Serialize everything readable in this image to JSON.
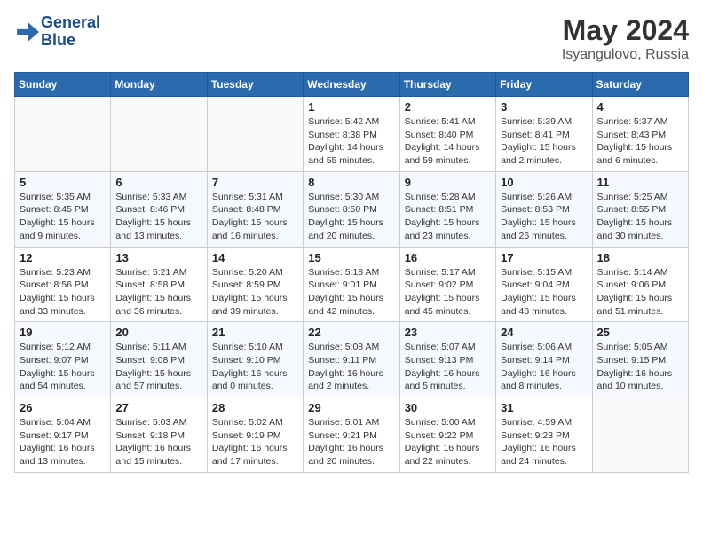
{
  "header": {
    "logo_line1": "General",
    "logo_line2": "Blue",
    "month_title": "May 2024",
    "location": "Isyangulovo, Russia"
  },
  "days_of_week": [
    "Sunday",
    "Monday",
    "Tuesday",
    "Wednesday",
    "Thursday",
    "Friday",
    "Saturday"
  ],
  "weeks": [
    [
      {
        "day": "",
        "info": ""
      },
      {
        "day": "",
        "info": ""
      },
      {
        "day": "",
        "info": ""
      },
      {
        "day": "1",
        "info": "Sunrise: 5:42 AM\nSunset: 8:38 PM\nDaylight: 14 hours\nand 55 minutes."
      },
      {
        "day": "2",
        "info": "Sunrise: 5:41 AM\nSunset: 8:40 PM\nDaylight: 14 hours\nand 59 minutes."
      },
      {
        "day": "3",
        "info": "Sunrise: 5:39 AM\nSunset: 8:41 PM\nDaylight: 15 hours\nand 2 minutes."
      },
      {
        "day": "4",
        "info": "Sunrise: 5:37 AM\nSunset: 8:43 PM\nDaylight: 15 hours\nand 6 minutes."
      }
    ],
    [
      {
        "day": "5",
        "info": "Sunrise: 5:35 AM\nSunset: 8:45 PM\nDaylight: 15 hours\nand 9 minutes."
      },
      {
        "day": "6",
        "info": "Sunrise: 5:33 AM\nSunset: 8:46 PM\nDaylight: 15 hours\nand 13 minutes."
      },
      {
        "day": "7",
        "info": "Sunrise: 5:31 AM\nSunset: 8:48 PM\nDaylight: 15 hours\nand 16 minutes."
      },
      {
        "day": "8",
        "info": "Sunrise: 5:30 AM\nSunset: 8:50 PM\nDaylight: 15 hours\nand 20 minutes."
      },
      {
        "day": "9",
        "info": "Sunrise: 5:28 AM\nSunset: 8:51 PM\nDaylight: 15 hours\nand 23 minutes."
      },
      {
        "day": "10",
        "info": "Sunrise: 5:26 AM\nSunset: 8:53 PM\nDaylight: 15 hours\nand 26 minutes."
      },
      {
        "day": "11",
        "info": "Sunrise: 5:25 AM\nSunset: 8:55 PM\nDaylight: 15 hours\nand 30 minutes."
      }
    ],
    [
      {
        "day": "12",
        "info": "Sunrise: 5:23 AM\nSunset: 8:56 PM\nDaylight: 15 hours\nand 33 minutes."
      },
      {
        "day": "13",
        "info": "Sunrise: 5:21 AM\nSunset: 8:58 PM\nDaylight: 15 hours\nand 36 minutes."
      },
      {
        "day": "14",
        "info": "Sunrise: 5:20 AM\nSunset: 8:59 PM\nDaylight: 15 hours\nand 39 minutes."
      },
      {
        "day": "15",
        "info": "Sunrise: 5:18 AM\nSunset: 9:01 PM\nDaylight: 15 hours\nand 42 minutes."
      },
      {
        "day": "16",
        "info": "Sunrise: 5:17 AM\nSunset: 9:02 PM\nDaylight: 15 hours\nand 45 minutes."
      },
      {
        "day": "17",
        "info": "Sunrise: 5:15 AM\nSunset: 9:04 PM\nDaylight: 15 hours\nand 48 minutes."
      },
      {
        "day": "18",
        "info": "Sunrise: 5:14 AM\nSunset: 9:06 PM\nDaylight: 15 hours\nand 51 minutes."
      }
    ],
    [
      {
        "day": "19",
        "info": "Sunrise: 5:12 AM\nSunset: 9:07 PM\nDaylight: 15 hours\nand 54 minutes."
      },
      {
        "day": "20",
        "info": "Sunrise: 5:11 AM\nSunset: 9:08 PM\nDaylight: 15 hours\nand 57 minutes."
      },
      {
        "day": "21",
        "info": "Sunrise: 5:10 AM\nSunset: 9:10 PM\nDaylight: 16 hours\nand 0 minutes."
      },
      {
        "day": "22",
        "info": "Sunrise: 5:08 AM\nSunset: 9:11 PM\nDaylight: 16 hours\nand 2 minutes."
      },
      {
        "day": "23",
        "info": "Sunrise: 5:07 AM\nSunset: 9:13 PM\nDaylight: 16 hours\nand 5 minutes."
      },
      {
        "day": "24",
        "info": "Sunrise: 5:06 AM\nSunset: 9:14 PM\nDaylight: 16 hours\nand 8 minutes."
      },
      {
        "day": "25",
        "info": "Sunrise: 5:05 AM\nSunset: 9:15 PM\nDaylight: 16 hours\nand 10 minutes."
      }
    ],
    [
      {
        "day": "26",
        "info": "Sunrise: 5:04 AM\nSunset: 9:17 PM\nDaylight: 16 hours\nand 13 minutes."
      },
      {
        "day": "27",
        "info": "Sunrise: 5:03 AM\nSunset: 9:18 PM\nDaylight: 16 hours\nand 15 minutes."
      },
      {
        "day": "28",
        "info": "Sunrise: 5:02 AM\nSunset: 9:19 PM\nDaylight: 16 hours\nand 17 minutes."
      },
      {
        "day": "29",
        "info": "Sunrise: 5:01 AM\nSunset: 9:21 PM\nDaylight: 16 hours\nand 20 minutes."
      },
      {
        "day": "30",
        "info": "Sunrise: 5:00 AM\nSunset: 9:22 PM\nDaylight: 16 hours\nand 22 minutes."
      },
      {
        "day": "31",
        "info": "Sunrise: 4:59 AM\nSunset: 9:23 PM\nDaylight: 16 hours\nand 24 minutes."
      },
      {
        "day": "",
        "info": ""
      }
    ]
  ]
}
